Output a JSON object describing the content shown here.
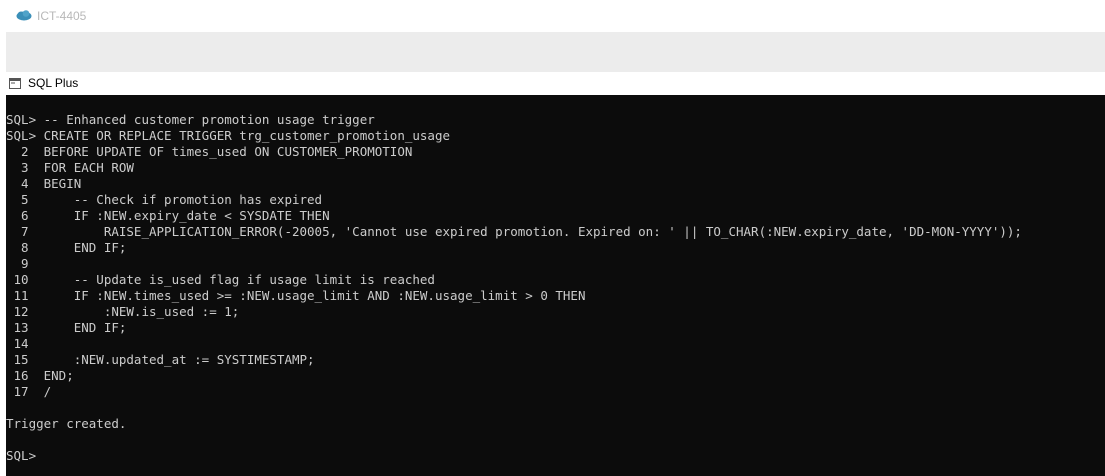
{
  "window": {
    "tab_title": "ICT-4405",
    "app_title": "SQL Plus",
    "cloud_icon": "cloud-icon",
    "app_icon": "console-window-icon"
  },
  "colors": {
    "console_bg": "#0c0c0c",
    "console_text": "#cccccc",
    "cloud": "#3a8fb8"
  },
  "console": {
    "lines": [
      "SQL> -- Enhanced customer promotion usage trigger",
      "SQL> CREATE OR REPLACE TRIGGER trg_customer_promotion_usage",
      "  2  BEFORE UPDATE OF times_used ON CUSTOMER_PROMOTION",
      "  3  FOR EACH ROW",
      "  4  BEGIN",
      "  5      -- Check if promotion has expired",
      "  6      IF :NEW.expiry_date < SYSDATE THEN",
      "  7          RAISE_APPLICATION_ERROR(-20005, 'Cannot use expired promotion. Expired on: ' || TO_CHAR(:NEW.expiry_date, 'DD-MON-YYYY'));",
      "  8      END IF;",
      "  9",
      " 10      -- Update is_used flag if usage limit is reached",
      " 11      IF :NEW.times_used >= :NEW.usage_limit AND :NEW.usage_limit > 0 THEN",
      " 12          :NEW.is_used := 1;",
      " 13      END IF;",
      " 14",
      " 15      :NEW.updated_at := SYSTIMESTAMP;",
      " 16  END;",
      " 17  /",
      "",
      "Trigger created.",
      "",
      "SQL>"
    ]
  }
}
